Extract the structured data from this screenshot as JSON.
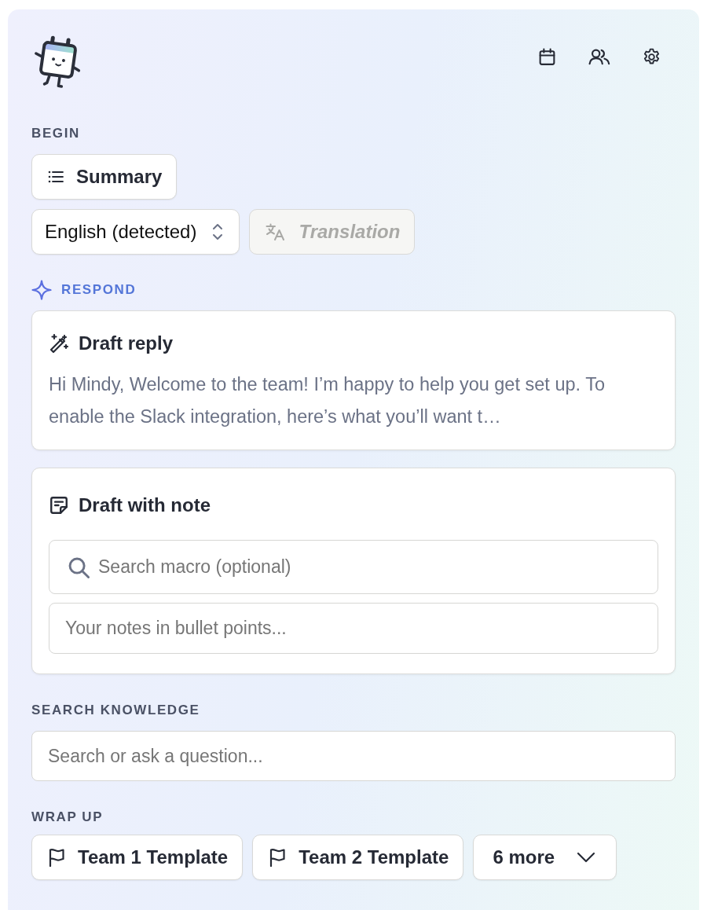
{
  "begin": {
    "label": "BEGIN",
    "summary_button": "Summary",
    "language_select": {
      "value": "English (detected)"
    },
    "translation_button": {
      "label": "Translation",
      "disabled": true
    }
  },
  "respond": {
    "label": "RESPOND",
    "draft_reply": {
      "title": "Draft reply",
      "preview": "Hi Mindy, Welcome to the team! I’m happy to help you get set up. To enable the Slack integration, here’s what you’ll want t…"
    },
    "draft_with_note": {
      "title": "Draft with note",
      "macro_search": {
        "placeholder": "Search macro (optional)"
      },
      "notes": {
        "placeholder": "Your notes in bullet points..."
      }
    }
  },
  "search_knowledge": {
    "label": "SEARCH KNOWLEDGE",
    "search": {
      "placeholder": "Search or ask a question..."
    }
  },
  "wrap_up": {
    "label": "WRAP UP",
    "templates": [
      {
        "label": "Team 1 Template"
      },
      {
        "label": "Team 2 Template"
      }
    ],
    "more_button": "6 more"
  }
}
